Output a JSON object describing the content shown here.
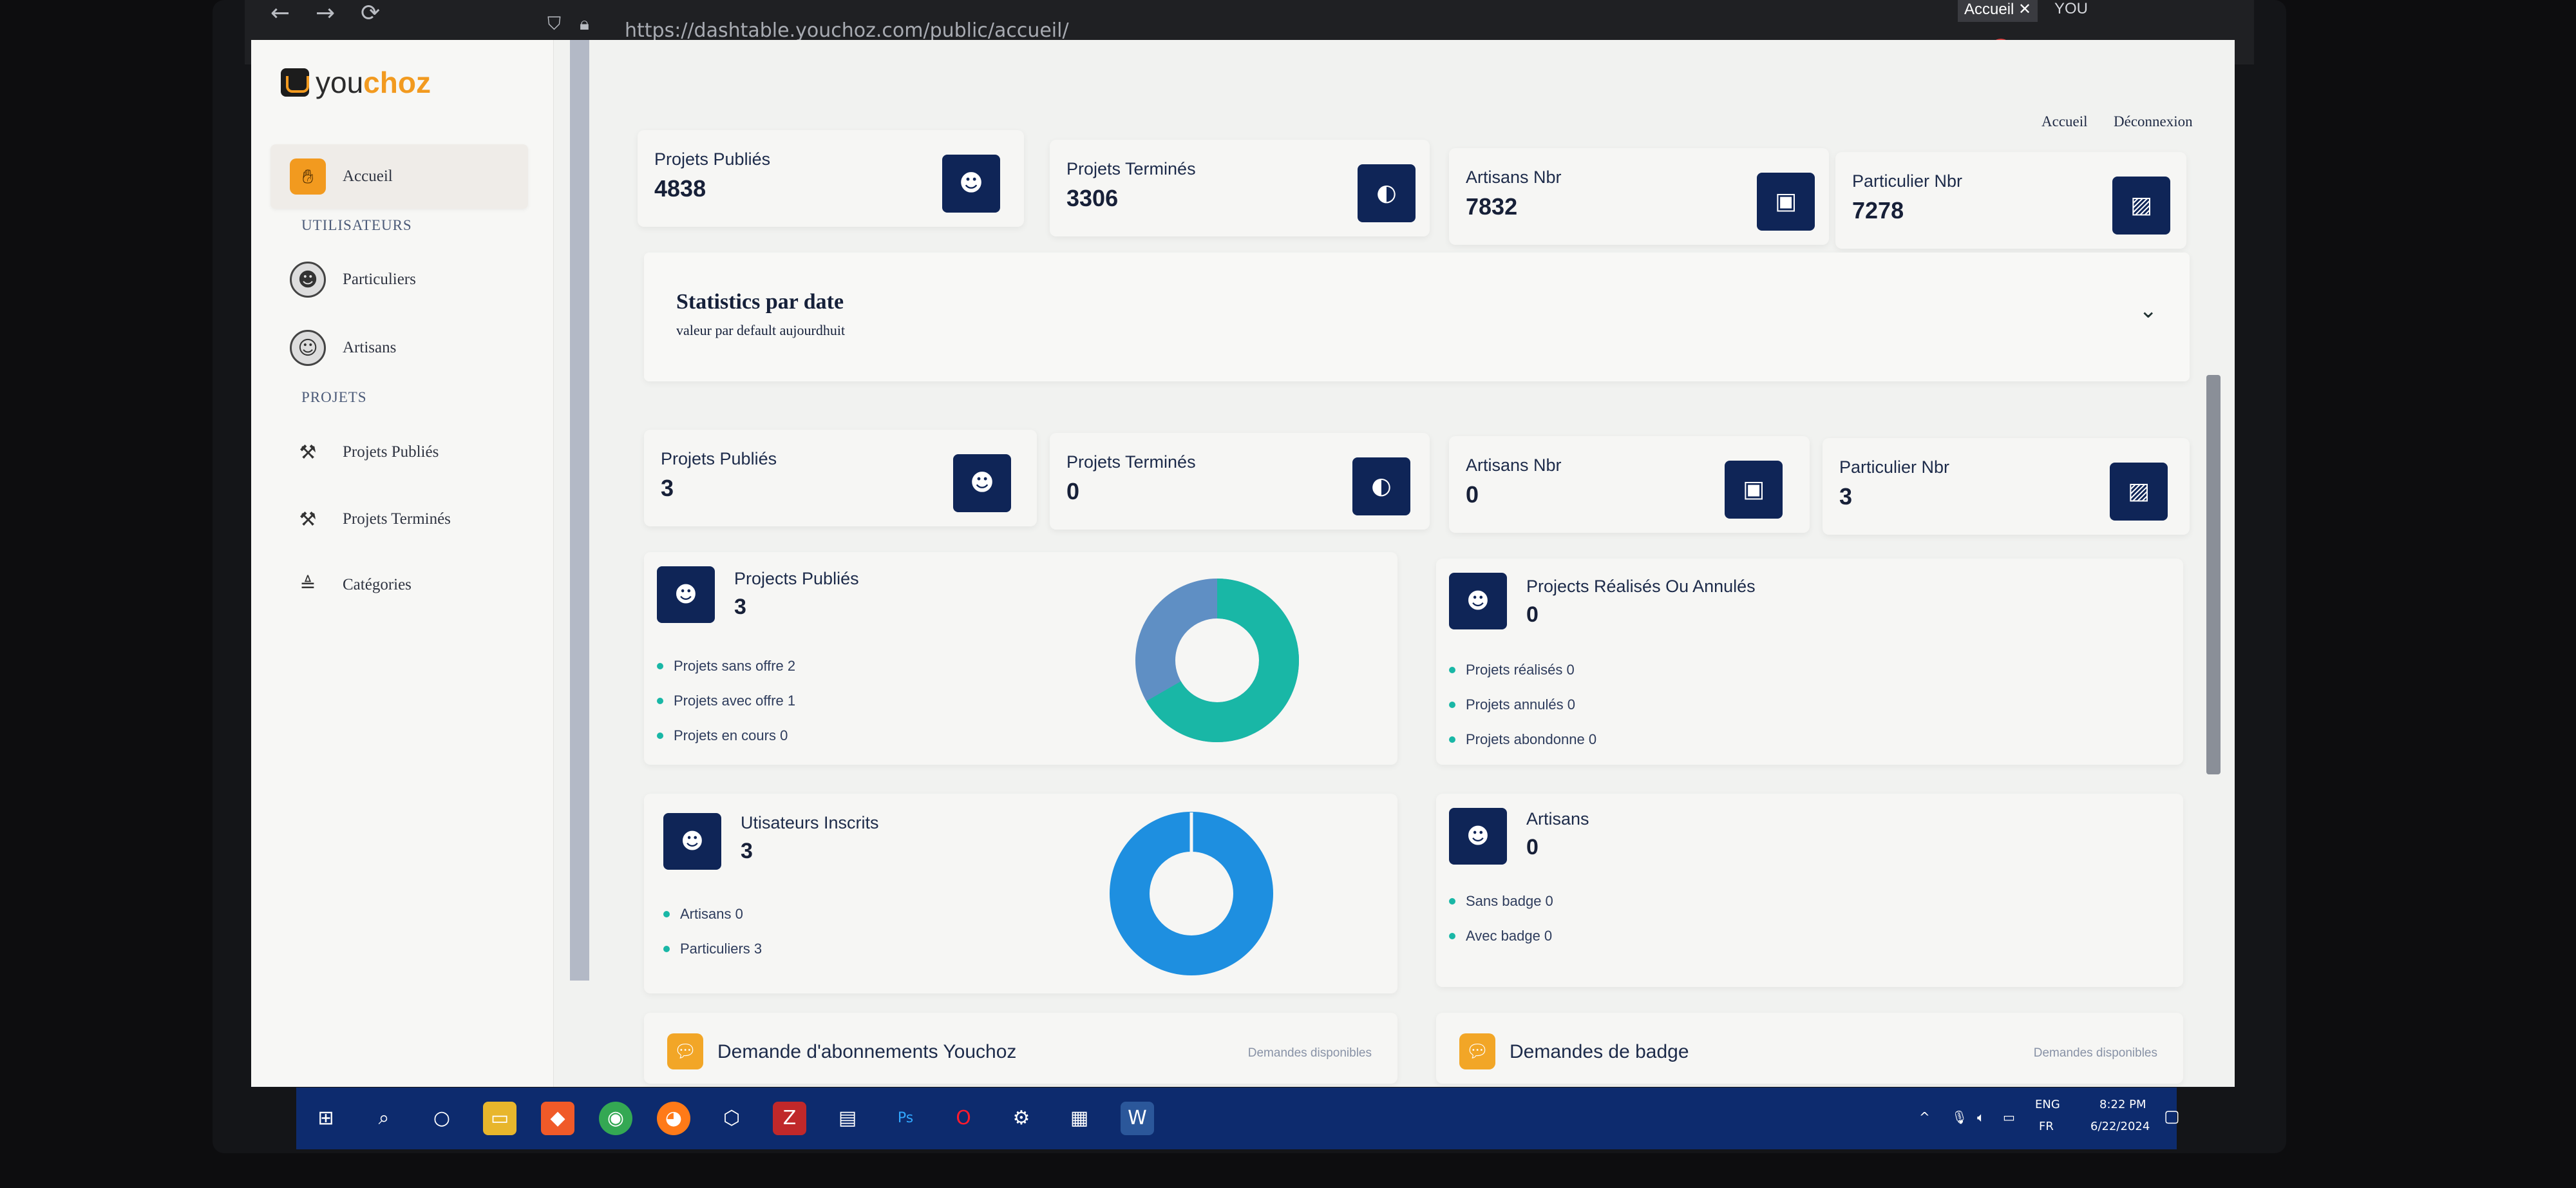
{
  "browser": {
    "url": "https://dashtable.youchoz.com/public/accueil/",
    "tabs": [
      "Accueil ✕",
      "YOU"
    ],
    "nav": {
      "back": "←",
      "forward": "→",
      "reload": "⟳"
    }
  },
  "sidebar": {
    "logo_you": "you",
    "logo_choz": "choz",
    "items": [
      {
        "label": "Accueil",
        "icon": "hand-icon"
      },
      {
        "label": "Particuliers",
        "icon": "user-icon"
      },
      {
        "label": "Artisans",
        "icon": "worker-icon"
      },
      {
        "label": "Projets Publiés",
        "icon": "hammer-icon"
      },
      {
        "label": "Projets Terminés",
        "icon": "hammer-icon"
      },
      {
        "label": "Catégories",
        "icon": "categories-icon"
      }
    ],
    "sections": {
      "users": "UTILISATEURS",
      "projects": "PROJETS"
    }
  },
  "header": {
    "home": "Accueil",
    "logout": "Déconnexion"
  },
  "top_stats": [
    {
      "label": "Projets Publiés",
      "value": "4838"
    },
    {
      "label": "Projets Terminés",
      "value": "3306"
    },
    {
      "label": "Artisans Nbr",
      "value": "7832"
    },
    {
      "label": "Particulier Nbr",
      "value": "7278"
    }
  ],
  "statistics": {
    "title": "Statistics par date",
    "subtitle": "valeur par default aujourdhuit"
  },
  "date_stats": [
    {
      "label": "Projets Publiés",
      "value": "3"
    },
    {
      "label": "Projets Terminés",
      "value": "0"
    },
    {
      "label": "Artisans Nbr",
      "value": "0"
    },
    {
      "label": "Particulier Nbr",
      "value": "3"
    }
  ],
  "projects_published": {
    "title": "Projects Publiés",
    "value": "3",
    "items": [
      "Projets sans offre 2",
      "Projets avec offre 1",
      "Projets en cours 0"
    ]
  },
  "projects_done": {
    "title": "Projects Réalisés Ou Annulés",
    "value": "0",
    "items": [
      "Projets réalisés 0",
      "Projets annulés 0",
      "Projets abondonne 0"
    ]
  },
  "users": {
    "title": "Utisateurs Inscrits",
    "value": "3",
    "items": [
      "Artisans 0",
      "Particuliers 3"
    ]
  },
  "artisans": {
    "title": "Artisans",
    "value": "0",
    "items": [
      "Sans badge 0",
      "Avec badge 0"
    ]
  },
  "footer_cards": [
    {
      "title": "Demande d'abonnements Youchoz",
      "right": "Demandes disponibles"
    },
    {
      "title": "Demandes de badge",
      "right": "Demandes disponibles"
    }
  ],
  "taskbar": {
    "lang_top": "ENG",
    "lang_bottom": "FR",
    "time": "8:22 PM",
    "date": "6/22/2024"
  },
  "colors": {
    "navy": "#0f2557",
    "teal": "#19b7a6",
    "blue": "#1e8fe0",
    "orange": "#f29a1f"
  }
}
